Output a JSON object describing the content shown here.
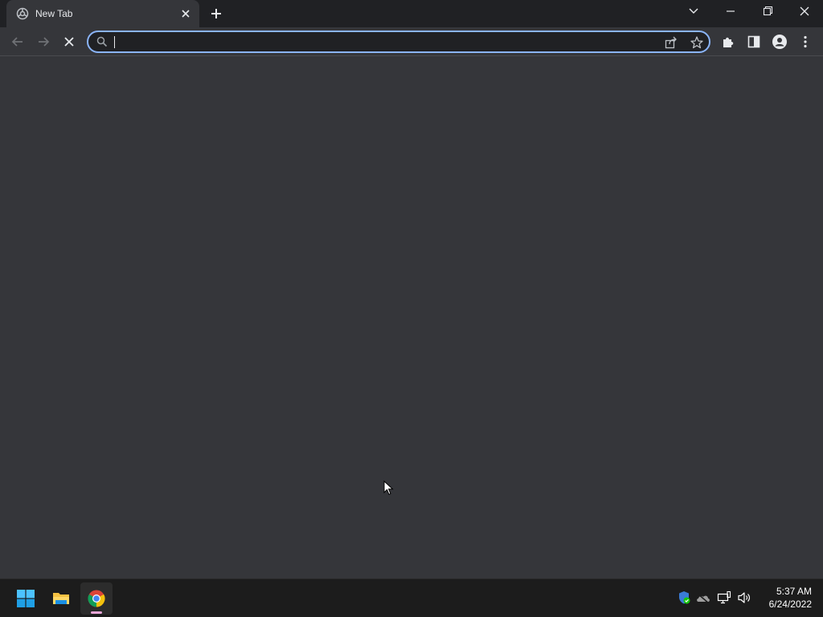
{
  "browser": {
    "tab": {
      "title": "New Tab",
      "favicon": "chrome-new-tab-icon"
    },
    "new_tab_icon": "plus-icon",
    "window_controls": [
      "chevron-down-icon",
      "minimize-icon",
      "restore-icon",
      "close-icon"
    ],
    "toolbar": {
      "back": "arrow-left-icon",
      "forward": "arrow-right-icon",
      "stop": "stop-x-icon",
      "omnibox": {
        "value": "",
        "search_icon": "search-icon",
        "share_icon": "share-icon",
        "bookmark_icon": "star-icon"
      },
      "extensions": "puzzle-icon",
      "side_panel": "side-panel-icon",
      "profile": "person-icon",
      "menu": "kebab-menu-icon"
    },
    "accent_color": "#8ab4f8",
    "background_color": "#35363a"
  },
  "taskbar": {
    "apps": [
      {
        "name": "Start",
        "icon": "windows-icon"
      },
      {
        "name": "File Explorer",
        "icon": "folder-icon"
      },
      {
        "name": "Google Chrome",
        "icon": "chrome-icon",
        "active": true
      }
    ],
    "tray": [
      "defender-icon",
      "onedrive-icon",
      "network-icon",
      "volume-icon"
    ],
    "clock": {
      "time": "5:37 AM",
      "date": "6/24/2022"
    }
  }
}
